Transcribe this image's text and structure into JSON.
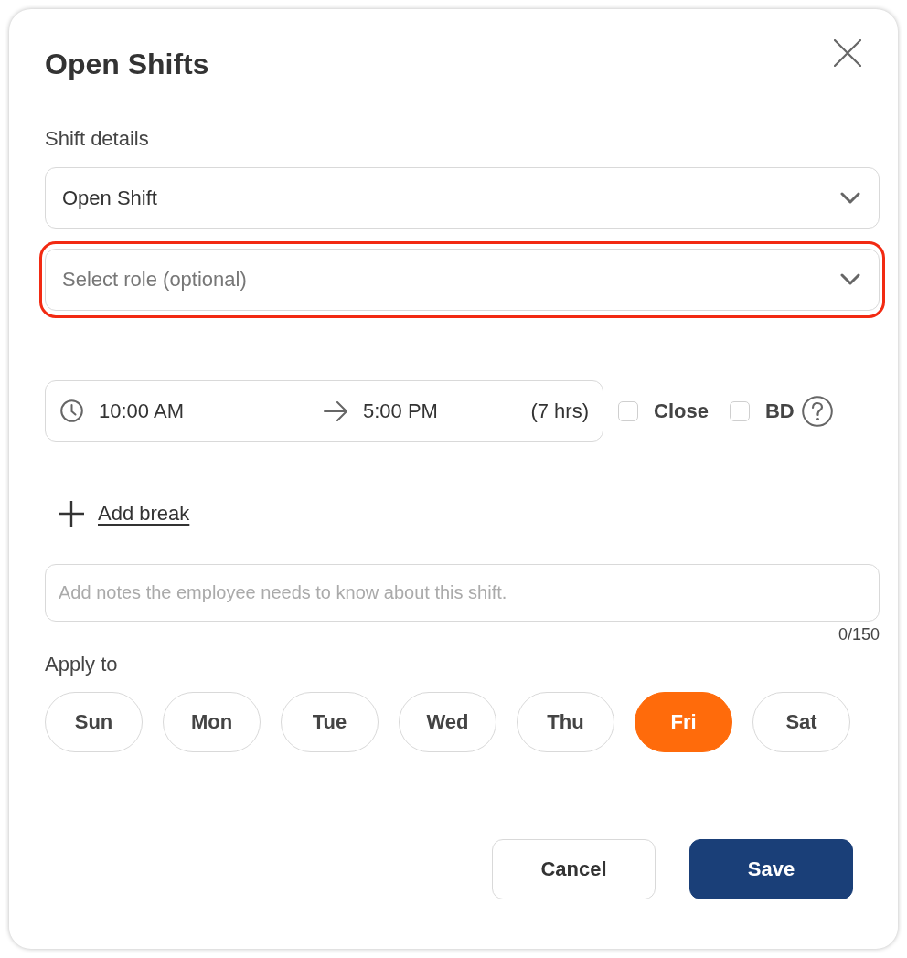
{
  "dialog": {
    "title": "Open Shifts"
  },
  "shift_details": {
    "label": "Shift details",
    "selects": [
      {
        "value": "Open Shift",
        "highlighted": false
      },
      {
        "placeholder": "Select role (optional)",
        "highlighted": true
      }
    ]
  },
  "time_range": {
    "start": "10:00 AM",
    "end": "5:00 PM",
    "duration": "(7 hrs)"
  },
  "options": [
    {
      "label": "Close",
      "checked": false
    },
    {
      "label": "BD",
      "checked": false
    }
  ],
  "add_break": {
    "label": "Add break"
  },
  "notes": {
    "placeholder": "Add notes the employee needs to know about this shift.",
    "counter": "0/150"
  },
  "apply_to": {
    "label": "Apply to",
    "days": [
      {
        "label": "Sun",
        "selected": false
      },
      {
        "label": "Mon",
        "selected": false
      },
      {
        "label": "Tue",
        "selected": false
      },
      {
        "label": "Wed",
        "selected": false
      },
      {
        "label": "Thu",
        "selected": false
      },
      {
        "label": "Fri",
        "selected": true
      },
      {
        "label": "Sat",
        "selected": false
      }
    ]
  },
  "buttons": [
    {
      "label": "Cancel",
      "kind": "secondary"
    },
    {
      "label": "Save",
      "kind": "primary"
    }
  ]
}
